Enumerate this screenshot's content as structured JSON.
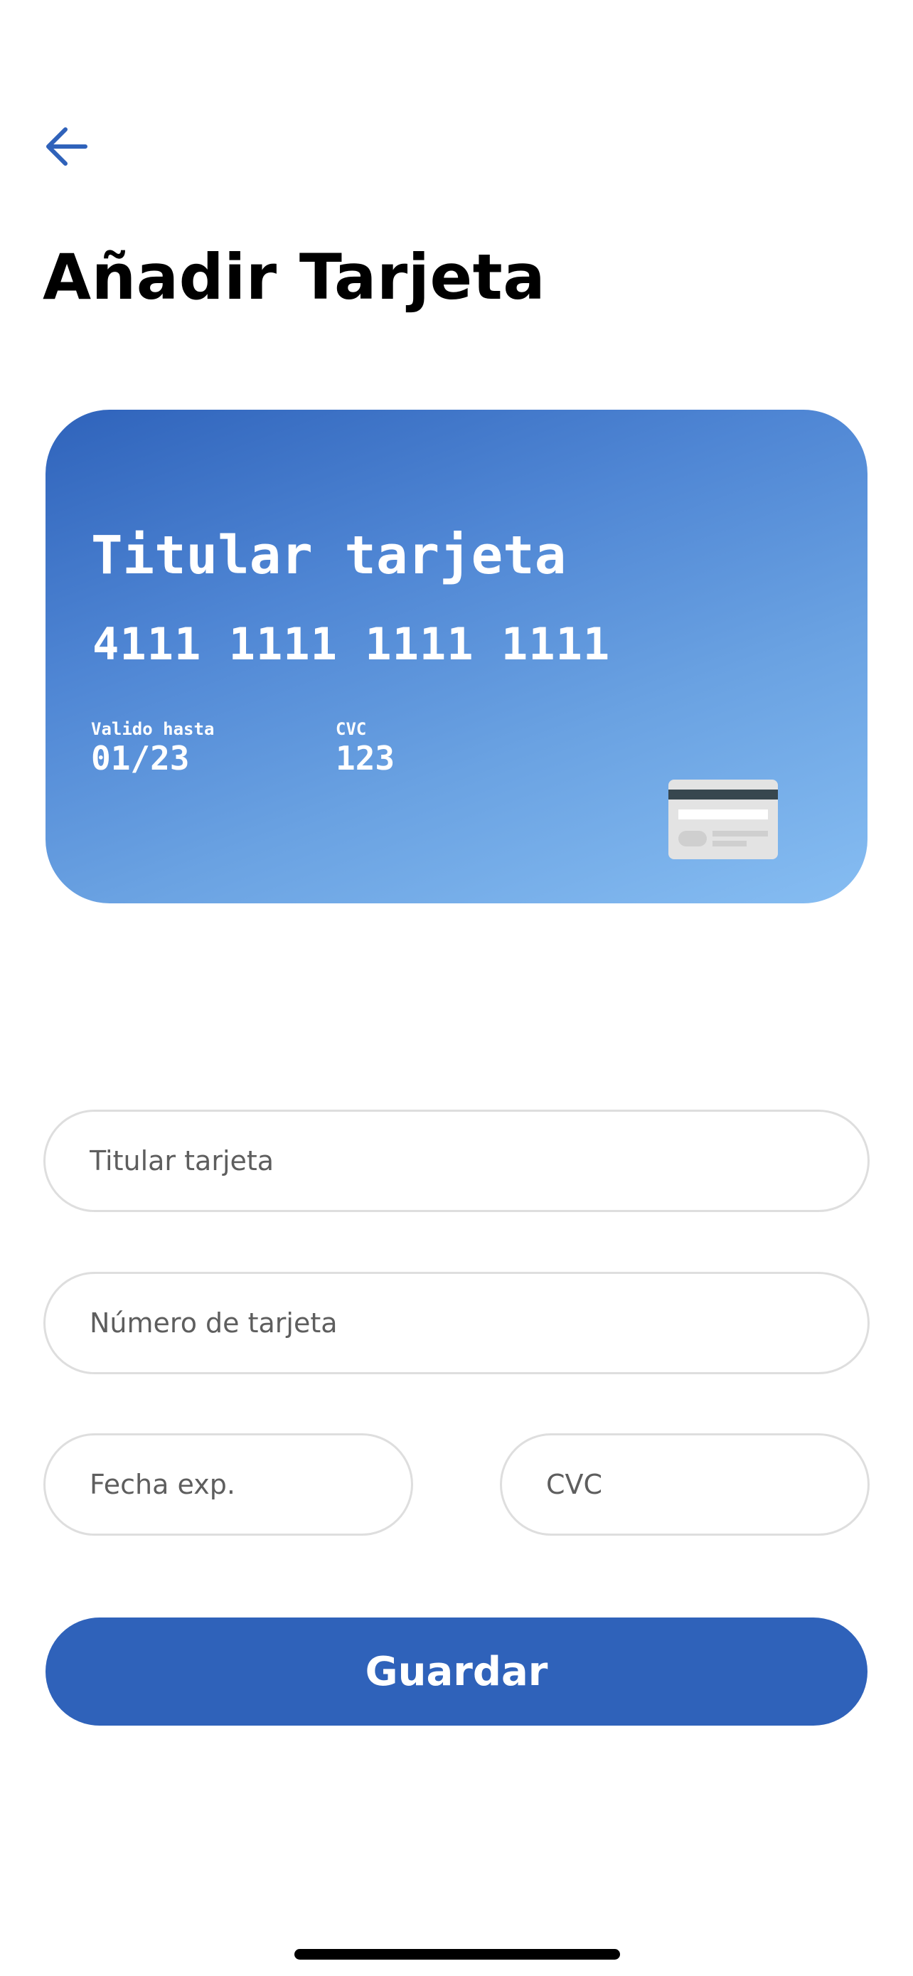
{
  "header": {
    "title": "Añadir Tarjeta",
    "back_icon": "arrow-left-icon",
    "accent_color": "#2f62ba"
  },
  "card_preview": {
    "holder": "Titular tarjeta",
    "number": "4111 1111 1111 1111",
    "expiry_label": "Valido hasta",
    "expiry_value": "01/23",
    "cvc_label": "CVC",
    "cvc_value": "123",
    "gradient_start": "#2f63bb",
    "gradient_end": "#86bdf2",
    "icon": "credit-card-icon"
  },
  "form": {
    "holder_placeholder": "Titular tarjeta",
    "number_placeholder": "Número de tarjeta",
    "expiry_placeholder": "Fecha exp.",
    "cvc_placeholder": "CVC",
    "holder_value": "",
    "number_value": "",
    "expiry_value": "",
    "cvc_value": ""
  },
  "actions": {
    "save_label": "Guardar",
    "save_color": "#2f62ba"
  }
}
